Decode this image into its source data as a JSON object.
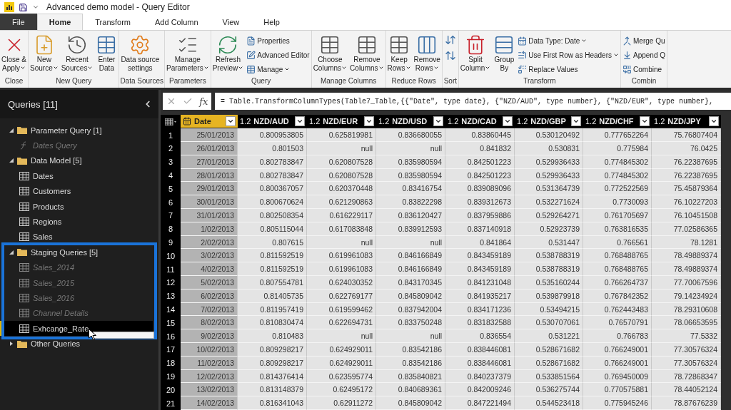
{
  "window": {
    "title": "Advanced demo model - Query Editor"
  },
  "tabs": [
    {
      "label": "File",
      "kind": "file",
      "selected": false
    },
    {
      "label": "Home",
      "kind": "tab",
      "selected": true
    },
    {
      "label": "Transform",
      "kind": "tab",
      "selected": false
    },
    {
      "label": "Add Column",
      "kind": "tab",
      "selected": false
    },
    {
      "label": "View",
      "kind": "tab",
      "selected": false
    },
    {
      "label": "Help",
      "kind": "tab",
      "selected": false
    }
  ],
  "ribbon": [
    {
      "label": "Close",
      "buttons": [
        {
          "kind": "large",
          "label": "Close &\nApply",
          "dropdown": true
        }
      ]
    },
    {
      "label": "New Query",
      "buttons": [
        {
          "kind": "large",
          "label": "New\nSource",
          "dropdown": true
        },
        {
          "kind": "large",
          "label": "Recent\nSources",
          "dropdown": true
        },
        {
          "kind": "large",
          "label": "Enter\nData",
          "dropdown": false
        }
      ]
    },
    {
      "label": "Data Sources",
      "buttons": [
        {
          "kind": "large",
          "label": "Data source\nsettings",
          "dropdown": false
        }
      ]
    },
    {
      "label": "Parameters",
      "buttons": [
        {
          "kind": "large",
          "label": "Manage\nParameters",
          "dropdown": true
        }
      ]
    },
    {
      "label": "Query",
      "buttons": [
        {
          "kind": "large",
          "label": "Refresh\nPreview",
          "dropdown": true
        },
        {
          "kind": "small",
          "label": "Properties",
          "dropdown": false
        },
        {
          "kind": "small",
          "label": "Advanced Editor",
          "dropdown": false
        },
        {
          "kind": "small",
          "label": "Manage",
          "dropdown": true
        }
      ]
    },
    {
      "label": "Manage Columns",
      "buttons": [
        {
          "kind": "large",
          "label": "Choose\nColumns",
          "dropdown": true
        },
        {
          "kind": "large",
          "label": "Remove\nColumns",
          "dropdown": true
        }
      ]
    },
    {
      "label": "Reduce Rows",
      "buttons": [
        {
          "kind": "large",
          "label": "Keep\nRows",
          "dropdown": true
        },
        {
          "kind": "large",
          "label": "Remove\nRows",
          "dropdown": true
        }
      ]
    },
    {
      "label": "Sort",
      "buttons": [
        {
          "kind": "icon",
          "dropdown": false
        },
        {
          "kind": "icon",
          "dropdown": false
        }
      ]
    },
    {
      "label": "Transform",
      "buttons": [
        {
          "kind": "large",
          "label": "Split\nColumn",
          "dropdown": true
        },
        {
          "kind": "large",
          "label": "Group\nBy",
          "dropdown": false
        },
        {
          "kind": "small",
          "label": "Data Type: Date",
          "dropdown": true
        },
        {
          "kind": "small",
          "label": "Use First Row as Headers",
          "dropdown": true
        },
        {
          "kind": "small",
          "label": "Replace Values",
          "dropdown": false
        }
      ]
    },
    {
      "label": "Combin",
      "buttons": [
        {
          "kind": "small",
          "label": "Merge Qu",
          "dropdown": false
        },
        {
          "kind": "small",
          "label": "Append Q",
          "dropdown": false
        },
        {
          "kind": "small",
          "label": "Combine",
          "dropdown": false
        }
      ]
    }
  ],
  "queries_pane": {
    "title": "Queries [11]",
    "tree": [
      {
        "label": "Parameter Query [1]",
        "expanded": true,
        "children": [
          {
            "label": "Dates Query",
            "kind": "function",
            "load_enabled": false,
            "selected": false
          }
        ]
      },
      {
        "label": "Data Model [5]",
        "expanded": true,
        "children": [
          {
            "label": "Dates",
            "kind": "table",
            "load_enabled": true,
            "selected": false
          },
          {
            "label": "Customers",
            "kind": "table",
            "load_enabled": true,
            "selected": false
          },
          {
            "label": "Products",
            "kind": "table",
            "load_enabled": true,
            "selected": false
          },
          {
            "label": "Regions",
            "kind": "table",
            "load_enabled": true,
            "selected": false
          },
          {
            "label": "Sales",
            "kind": "table",
            "load_enabled": true,
            "selected": false
          }
        ]
      },
      {
        "label": "Staging Queries [5]",
        "expanded": true,
        "children": [
          {
            "label": "Sales_2014",
            "kind": "table",
            "load_enabled": false,
            "selected": false
          },
          {
            "label": "Sales_2015",
            "kind": "table",
            "load_enabled": false,
            "selected": false
          },
          {
            "label": "Sales_2016",
            "kind": "table",
            "load_enabled": false,
            "selected": false
          },
          {
            "label": "Channel Details",
            "kind": "table",
            "load_enabled": false,
            "selected": false
          },
          {
            "label": "Exhcange_Rate",
            "kind": "table",
            "load_enabled": true,
            "selected": true
          }
        ]
      },
      {
        "label": "Other Queries",
        "expanded": false
      }
    ]
  },
  "formula_bar": {
    "fx_label": "fx",
    "formula": "= Table.TransformColumnTypes(Table7_Table,{{\"Date\", type date}, {\"NZD/AUD\", type number}, {\"NZD/EUR\", type number},"
  },
  "table": {
    "columns": [
      {
        "kind": "index",
        "selected": false
      },
      {
        "name": "Date",
        "kind": "date",
        "selected": true
      },
      {
        "name": "NZD/AUD",
        "kind": "number",
        "type_label": "1.2",
        "selected": false
      },
      {
        "name": "NZD/EUR",
        "kind": "number",
        "type_label": "1.2",
        "selected": false
      },
      {
        "name": "NZD/USD",
        "kind": "number",
        "type_label": "1.2",
        "selected": false
      },
      {
        "name": "NZD/CAD",
        "kind": "number",
        "type_label": "1.2",
        "selected": false
      },
      {
        "name": "NZD/GBP",
        "kind": "number",
        "type_label": "1.2",
        "selected": false
      },
      {
        "name": "NZD/CHF",
        "kind": "number",
        "type_label": "1.2",
        "selected": false
      },
      {
        "name": "NZD/JPY",
        "kind": "number",
        "type_label": "1.2",
        "selected": false
      }
    ],
    "rows": [
      [
        "1",
        "25/01/2013",
        "0.800953805",
        "0.625819981",
        "0.836680055",
        "0.83860445",
        "0.530120492",
        "0.777652264",
        "75.76807404"
      ],
      [
        "2",
        "26/01/2013",
        "0.801503",
        "null",
        "null",
        "0.841832",
        "0.530831",
        "0.775984",
        "76.0425"
      ],
      [
        "3",
        "27/01/2013",
        "0.802783847",
        "0.620807528",
        "0.835980594",
        "0.842501223",
        "0.529936433",
        "0.774845302",
        "76.22387695"
      ],
      [
        "4",
        "28/01/2013",
        "0.802783847",
        "0.620807528",
        "0.835980594",
        "0.842501223",
        "0.529936433",
        "0.774845302",
        "76.22387695"
      ],
      [
        "5",
        "29/01/2013",
        "0.800367057",
        "0.620370448",
        "0.83416754",
        "0.839089096",
        "0.531364739",
        "0.772522569",
        "75.45879364"
      ],
      [
        "6",
        "30/01/2013",
        "0.800670624",
        "0.621290863",
        "0.83822298",
        "0.839312673",
        "0.532271624",
        "0.7730093",
        "76.10227203"
      ],
      [
        "7",
        "31/01/2013",
        "0.802508354",
        "0.616229117",
        "0.836120427",
        "0.837959886",
        "0.529264271",
        "0.761705697",
        "76.10451508"
      ],
      [
        "8",
        "1/02/2013",
        "0.805115044",
        "0.617083848",
        "0.839912593",
        "0.837140918",
        "0.52923739",
        "0.763816535",
        "77.02586365"
      ],
      [
        "9",
        "2/02/2013",
        "0.807615",
        "null",
        "null",
        "0.841864",
        "0.531447",
        "0.766561",
        "78.1281"
      ],
      [
        "10",
        "3/02/2013",
        "0.811592519",
        "0.619961083",
        "0.846166849",
        "0.843459189",
        "0.538788319",
        "0.768488765",
        "78.49889374"
      ],
      [
        "11",
        "4/02/2013",
        "0.811592519",
        "0.619961083",
        "0.846166849",
        "0.843459189",
        "0.538788319",
        "0.768488765",
        "78.49889374"
      ],
      [
        "12",
        "5/02/2013",
        "0.807554781",
        "0.624030352",
        "0.843170345",
        "0.841231048",
        "0.535160244",
        "0.766264737",
        "77.70067596"
      ],
      [
        "13",
        "6/02/2013",
        "0.81405735",
        "0.622769177",
        "0.845809042",
        "0.841935217",
        "0.539879918",
        "0.767842352",
        "79.14234924"
      ],
      [
        "14",
        "7/02/2013",
        "0.811957419",
        "0.619599462",
        "0.837942004",
        "0.834171236",
        "0.53494215",
        "0.762443483",
        "78.29310608"
      ],
      [
        "15",
        "8/02/2013",
        "0.810830474",
        "0.622694731",
        "0.833750248",
        "0.831832588",
        "0.530707061",
        "0.76570791",
        "78.06653595"
      ],
      [
        "16",
        "9/02/2013",
        "0.810483",
        "null",
        "null",
        "0.836554",
        "0.531221",
        "0.766783",
        "77.5332"
      ],
      [
        "17",
        "10/02/2013",
        "0.809298217",
        "0.624929011",
        "0.83542186",
        "0.838446081",
        "0.528671682",
        "0.766249001",
        "77.30576324"
      ],
      [
        "18",
        "11/02/2013",
        "0.809298217",
        "0.624929011",
        "0.83542186",
        "0.838446081",
        "0.528671682",
        "0.766249001",
        "77.30576324"
      ],
      [
        "19",
        "12/02/2013",
        "0.814376414",
        "0.623595774",
        "0.835840821",
        "0.840237379",
        "0.533851564",
        "0.769450009",
        "78.72868347"
      ],
      [
        "20",
        "13/02/2013",
        "0.813148379",
        "0.62495172",
        "0.840689361",
        "0.842009246",
        "0.536275744",
        "0.770575881",
        "78.44052124"
      ],
      [
        "21",
        "14/02/2013",
        "0.816341043",
        "0.62911272",
        "0.845809042",
        "0.847221494",
        "0.544523418",
        "0.775945246",
        "78.87676239"
      ]
    ]
  }
}
